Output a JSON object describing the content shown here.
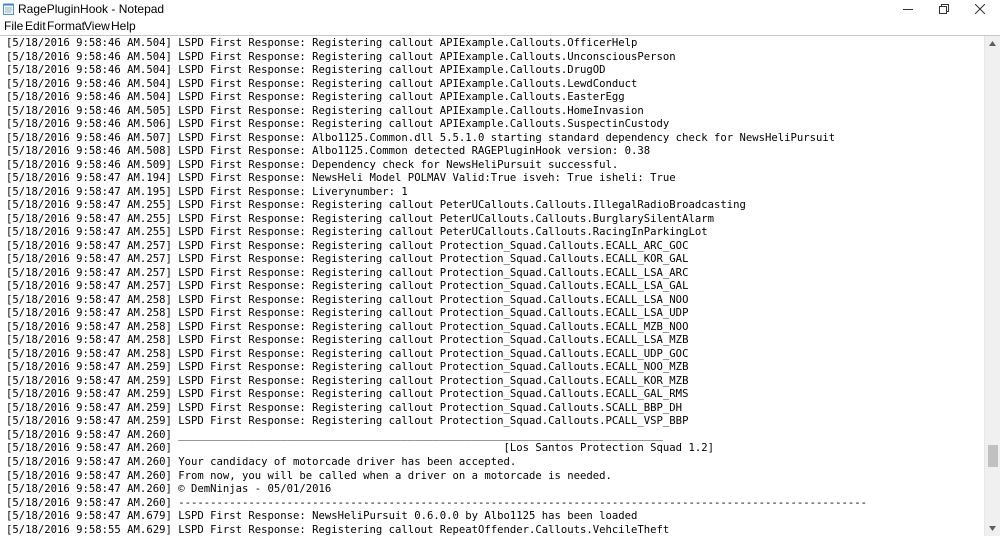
{
  "window": {
    "title": "RagePluginHook - Notepad",
    "controls": {
      "minimize_glyph": "—",
      "maximize_glyph": "□",
      "close_glyph": "✕"
    }
  },
  "menu": [
    "File",
    "Edit",
    "Format",
    "View",
    "Help"
  ],
  "editor": {
    "scroll_position": 0.88,
    "lines": [
      "[5/18/2016 9:58:46 AM.504] LSPD First Response: Registering callout APIExample.Callouts.OfficerHelp",
      "[5/18/2016 9:58:46 AM.504] LSPD First Response: Registering callout APIExample.Callouts.UnconsciousPerson",
      "[5/18/2016 9:58:46 AM.504] LSPD First Response: Registering callout APIExample.Callouts.DrugOD",
      "[5/18/2016 9:58:46 AM.504] LSPD First Response: Registering callout APIExample.Callouts.LewdConduct",
      "[5/18/2016 9:58:46 AM.504] LSPD First Response: Registering callout APIExample.Callouts.EasterEgg",
      "[5/18/2016 9:58:46 AM.505] LSPD First Response: Registering callout APIExample.Callouts.HomeInvasion",
      "[5/18/2016 9:58:46 AM.506] LSPD First Response: Registering callout APIExample.Callouts.SuspectinCustody",
      "[5/18/2016 9:58:46 AM.507] LSPD First Response: Albo1125.Common.dll 5.5.1.0 starting standard dependency check for NewsHeliPursuit",
      "[5/18/2016 9:58:46 AM.508] LSPD First Response: Albo1125.Common detected RAGEPluginHook version: 0.38",
      "[5/18/2016 9:58:46 AM.509] LSPD First Response: Dependency check for NewsHeliPursuit successful.",
      "[5/18/2016 9:58:47 AM.194] LSPD First Response: NewsHeli Model POLMAV Valid:True isveh: True isheli: True",
      "[5/18/2016 9:58:47 AM.195] LSPD First Response: Liverynumber: 1",
      "[5/18/2016 9:58:47 AM.255] LSPD First Response: Registering callout PeterUCallouts.Callouts.IllegalRadioBroadcasting",
      "[5/18/2016 9:58:47 AM.255] LSPD First Response: Registering callout PeterUCallouts.Callouts.BurglarySilentAlarm",
      "[5/18/2016 9:58:47 AM.255] LSPD First Response: Registering callout PeterUCallouts.Callouts.RacingInParkingLot",
      "[5/18/2016 9:58:47 AM.257] LSPD First Response: Registering callout Protection_Squad.Callouts.ECALL_ARC_GOC",
      "[5/18/2016 9:58:47 AM.257] LSPD First Response: Registering callout Protection_Squad.Callouts.ECALL_KOR_GAL",
      "[5/18/2016 9:58:47 AM.257] LSPD First Response: Registering callout Protection_Squad.Callouts.ECALL_LSA_ARC",
      "[5/18/2016 9:58:47 AM.257] LSPD First Response: Registering callout Protection_Squad.Callouts.ECALL_LSA_GAL",
      "[5/18/2016 9:58:47 AM.258] LSPD First Response: Registering callout Protection_Squad.Callouts.ECALL_LSA_NOO",
      "[5/18/2016 9:58:47 AM.258] LSPD First Response: Registering callout Protection_Squad.Callouts.ECALL_LSA_UDP",
      "[5/18/2016 9:58:47 AM.258] LSPD First Response: Registering callout Protection_Squad.Callouts.ECALL_MZB_NOO",
      "[5/18/2016 9:58:47 AM.258] LSPD First Response: Registering callout Protection_Squad.Callouts.ECALL_LSA_MZB",
      "[5/18/2016 9:58:47 AM.258] LSPD First Response: Registering callout Protection_Squad.Callouts.ECALL_UDP_GOC",
      "[5/18/2016 9:58:47 AM.259] LSPD First Response: Registering callout Protection_Squad.Callouts.ECALL_NOO_MZB",
      "[5/18/2016 9:58:47 AM.259] LSPD First Response: Registering callout Protection_Squad.Callouts.ECALL_KOR_MZB",
      "[5/18/2016 9:58:47 AM.259] LSPD First Response: Registering callout Protection_Squad.Callouts.ECALL_GAL_RMS",
      "[5/18/2016 9:58:47 AM.259] LSPD First Response: Registering callout Protection_Squad.Callouts.SCALL_BBP_DH",
      "[5/18/2016 9:58:47 AM.259] LSPD First Response: Registering callout Protection_Squad.Callouts.PCALL_VSP_BBP",
      "[5/18/2016 9:58:47 AM.260] ____________________________________________________________________________",
      "[5/18/2016 9:58:47 AM.260]                                                    [Los Santos Protection Squad 1.2]",
      "[5/18/2016 9:58:47 AM.260] Your candidacy of motorcade driver has been accepted.",
      "[5/18/2016 9:58:47 AM.260] From now, you will be called when a driver on a motorcade is needed.",
      "[5/18/2016 9:58:47 AM.260] © DemNinjas - 05/01/2016",
      "[5/18/2016 9:58:47 AM.260] ------------------------------------------------------------------------------------------------------------",
      "[5/18/2016 9:58:47 AM.679] LSPD First Response: NewsHeliPursuit 0.6.0.0 by Albo1125 has been loaded",
      "[5/18/2016 9:58:55 AM.629] LSPD First Response: Registering callout RepeatOffender.Callouts.VehcileTheft"
    ]
  }
}
